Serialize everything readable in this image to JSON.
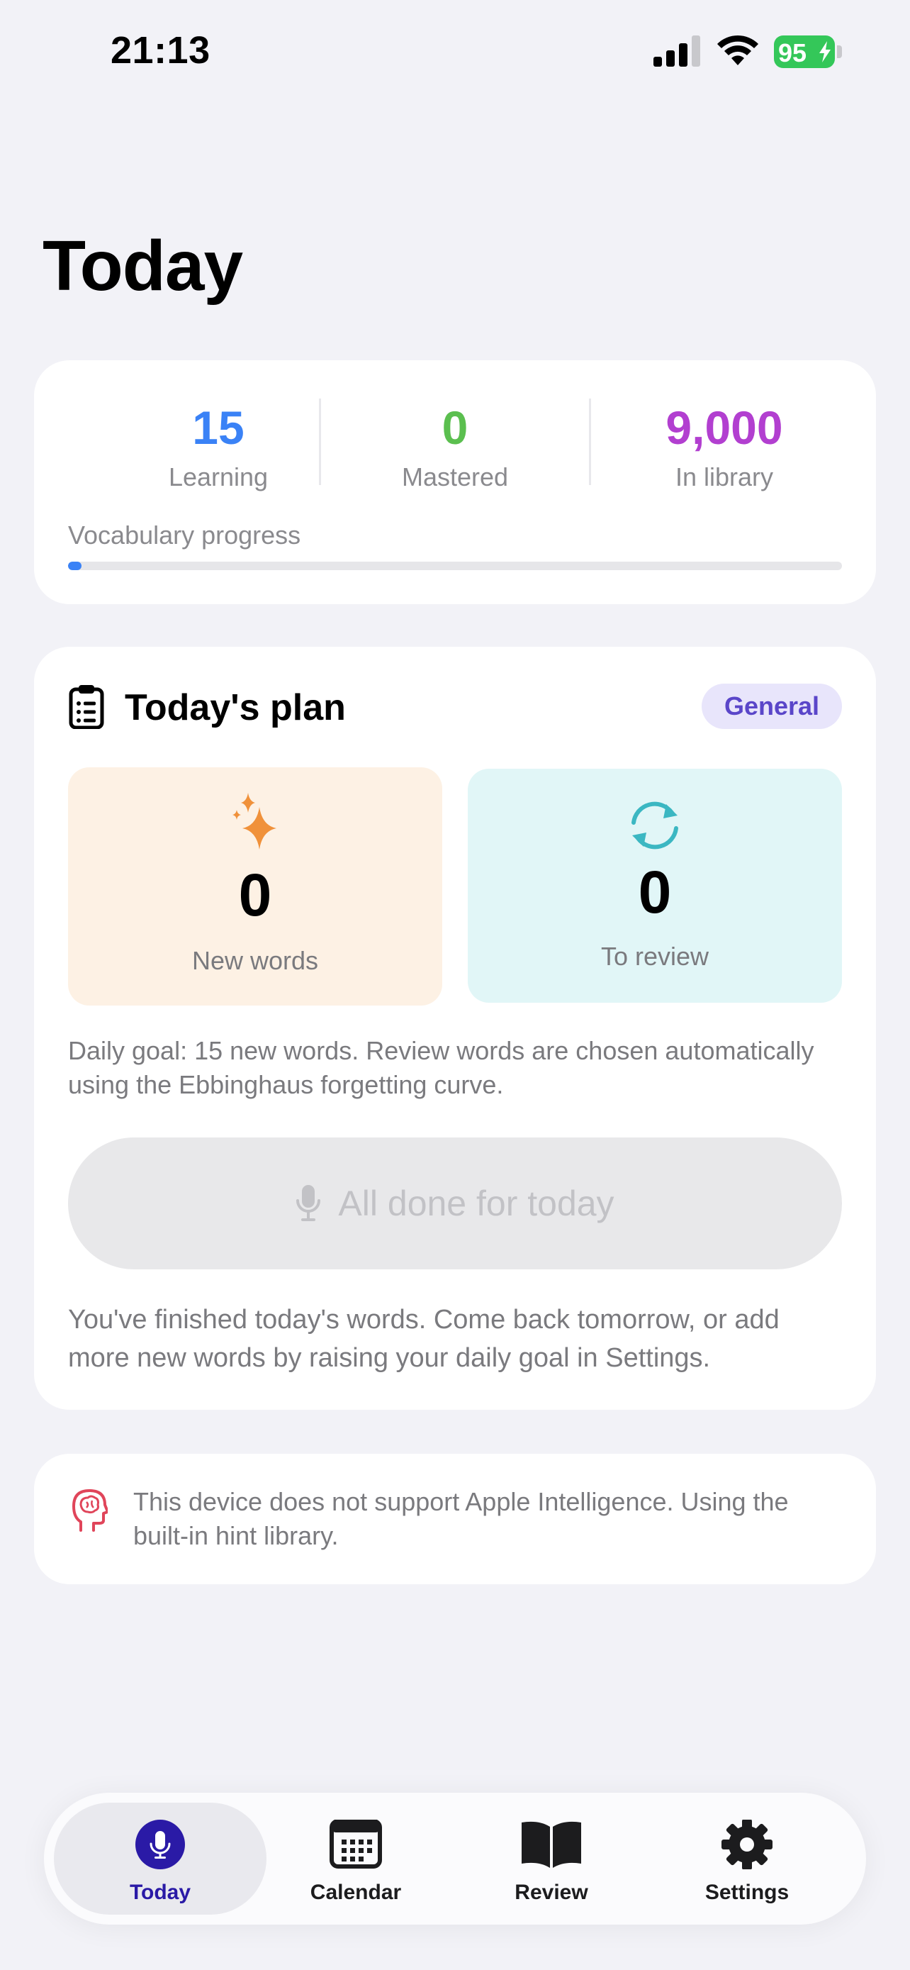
{
  "status_bar": {
    "time": "21:13",
    "battery": "95"
  },
  "page_title": "Today",
  "stats": {
    "learning": {
      "value": "15",
      "label": "Learning",
      "color": "#3a82f6"
    },
    "mastered": {
      "value": "0",
      "label": "Mastered",
      "color": "#5bbf4f"
    },
    "library": {
      "value": "9,000",
      "label": "In library",
      "color": "#b23fd0"
    },
    "progress_label": "Vocabulary progress",
    "progress_fraction": 0.017
  },
  "plan": {
    "title": "Today's plan",
    "badge": "General",
    "new_words": {
      "value": "0",
      "label": "New words"
    },
    "to_review": {
      "value": "0",
      "label": "To review"
    },
    "goal_text": "Daily goal: 15 new words. Review words are chosen automatically using the Ebbinghaus forgetting curve.",
    "done_button": "All done for today",
    "finished_text": "You've finished today's words. Come back tomorrow, or add more new words by raising your daily goal in Settings."
  },
  "ai_notice": "This device does not support Apple Intelligence. Using the built-in hint library.",
  "tabs": [
    {
      "label": "Today",
      "icon": "mic-icon",
      "active": true
    },
    {
      "label": "Calendar",
      "icon": "calendar-icon",
      "active": false
    },
    {
      "label": "Review",
      "icon": "book-icon",
      "active": false
    },
    {
      "label": "Settings",
      "icon": "gear-icon",
      "active": false
    }
  ]
}
